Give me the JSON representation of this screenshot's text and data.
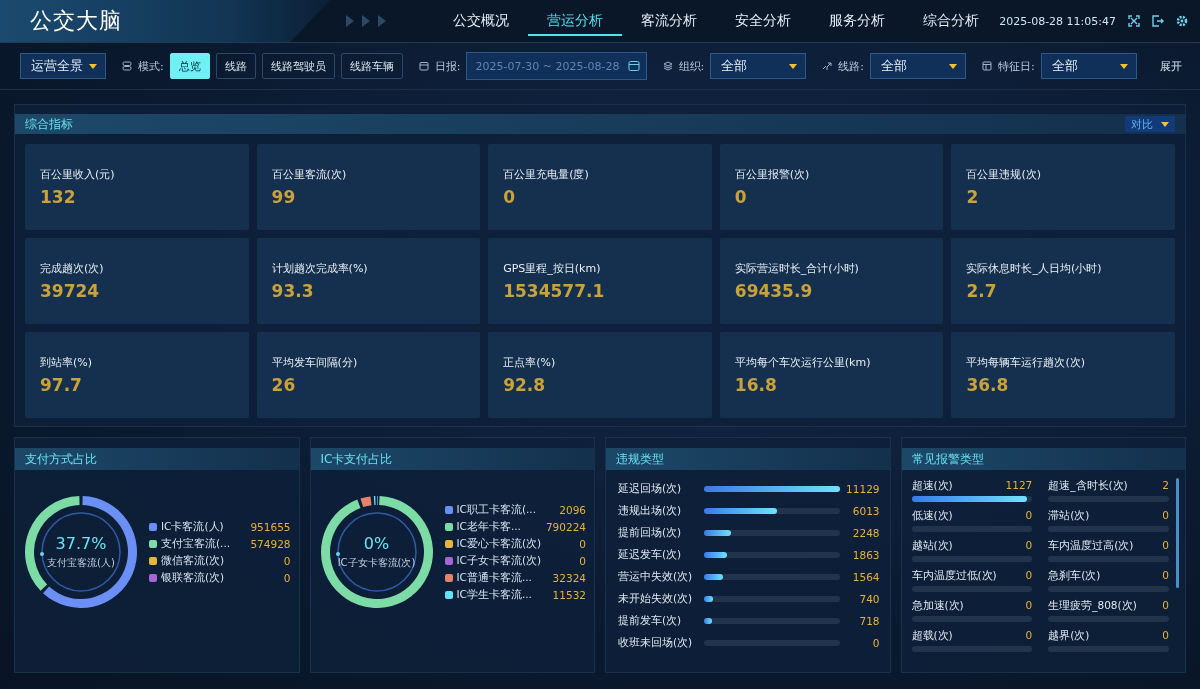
{
  "header": {
    "title": "公交大脑",
    "datetime": "2025-08-28 11:05:47"
  },
  "nav": [
    {
      "label": "公交概况",
      "selected": false
    },
    {
      "label": "营运分析",
      "selected": true
    },
    {
      "label": "客流分析",
      "selected": false
    },
    {
      "label": "安全分析",
      "selected": false
    },
    {
      "label": "服务分析",
      "selected": false
    },
    {
      "label": "综合分析",
      "selected": false
    }
  ],
  "filters": {
    "scene": "运营全景",
    "mode_label": "模式:",
    "modes": [
      {
        "label": "总览",
        "selected": true
      },
      {
        "label": "线路",
        "selected": false
      },
      {
        "label": "线路驾驶员",
        "selected": false
      },
      {
        "label": "线路车辆",
        "selected": false
      }
    ],
    "date_label": "日报:",
    "date_value": "2025-07-30 ~ 2025-08-28",
    "org_label": "组织:",
    "org_value": "全部",
    "route_label": "线路:",
    "route_value": "全部",
    "day_label": "特征日:",
    "day_value": "全部",
    "expand": "展开"
  },
  "metrics": {
    "title": "综合指标",
    "compare": "对比",
    "items": [
      {
        "label": "百公里收入(元)",
        "value": "132"
      },
      {
        "label": "百公里客流(次)",
        "value": "99"
      },
      {
        "label": "百公里充电量(度)",
        "value": "0"
      },
      {
        "label": "百公里报警(次)",
        "value": "0"
      },
      {
        "label": "百公里违规(次)",
        "value": "2"
      },
      {
        "label": "完成趟次(次)",
        "value": "39724"
      },
      {
        "label": "计划趟次完成率(%)",
        "value": "93.3"
      },
      {
        "label": "GPS里程_按日(km)",
        "value": "1534577.1"
      },
      {
        "label": "实际营运时长_合计(小时)",
        "value": "69435.9"
      },
      {
        "label": "实际休息时长_人日均(小时)",
        "value": "2.7"
      },
      {
        "label": "到站率(%)",
        "value": "97.7"
      },
      {
        "label": "平均发车间隔(分)",
        "value": "26"
      },
      {
        "label": "正点率(%)",
        "value": "92.8"
      },
      {
        "label": "平均每个车次运行公里(km)",
        "value": "16.8"
      },
      {
        "label": "平均每辆车运行趟次(次)",
        "value": "36.8"
      }
    ]
  },
  "payment": {
    "title": "支付方式占比",
    "center_value": "37.7%",
    "center_label": "支付宝客流(人)",
    "legend": [
      {
        "label": "IC卡客流(人)",
        "color": "#6b8ff5",
        "value": "951655"
      },
      {
        "label": "支付宝客流(...",
        "color": "#7ddba6",
        "value": "574928"
      },
      {
        "label": "微信客流(次)",
        "color": "#e6b43a",
        "value": "0"
      },
      {
        "label": "银联客流(次)",
        "color": "#a865d6",
        "value": "0"
      }
    ]
  },
  "ic_card": {
    "title": "IC卡支付占比",
    "center_value": "0%",
    "center_label": "IC子女卡客流(次)",
    "legend": [
      {
        "label": "IC职工卡客流(...",
        "color": "#6b8ff5",
        "value": "2096"
      },
      {
        "label": "IC老年卡客...",
        "color": "#7ddba6",
        "value": "790224"
      },
      {
        "label": "IC爱心卡客流(次)",
        "color": "#e6b43a",
        "value": "0"
      },
      {
        "label": "IC子女卡客流(次)",
        "color": "#a865d6",
        "value": "0"
      },
      {
        "label": "IC普通卡客流...",
        "color": "#e5826a",
        "value": "32324"
      },
      {
        "label": "IC学生卡客流...",
        "color": "#5fe3f5",
        "value": "11532"
      }
    ]
  },
  "violations": {
    "title": "违规类型",
    "items": [
      {
        "label": "延迟回场(次)",
        "value": "11129",
        "level": 1
      },
      {
        "label": "违规出场(次)",
        "value": "6013",
        "level": 0.54
      },
      {
        "label": "提前回场(次)",
        "value": "2248",
        "level": 0.2
      },
      {
        "label": "延迟发车(次)",
        "value": "1863",
        "level": 0.17
      },
      {
        "label": "营运中失效(次)",
        "value": "1564",
        "level": 0.14
      },
      {
        "label": "未开始失效(次)",
        "value": "740",
        "level": 0.07
      },
      {
        "label": "提前发车(次)",
        "value": "718",
        "level": 0.06
      },
      {
        "label": "收班未回场(次)",
        "value": "0"
      }
    ]
  },
  "alarms": {
    "title": "常见报警类型",
    "items": [
      {
        "label": "超速(次)",
        "value": "1127",
        "level": 0.96
      },
      {
        "label": "超速_含时长(次)",
        "value": "2"
      },
      {
        "label": "低速(次)",
        "value": "0"
      },
      {
        "label": "滞站(次)",
        "value": "0"
      },
      {
        "label": "越站(次)",
        "value": "0"
      },
      {
        "label": "车内温度过高(次)",
        "value": "0"
      },
      {
        "label": "车内温度过低(次)",
        "value": "0"
      },
      {
        "label": "急刹车(次)",
        "value": "0"
      },
      {
        "label": "急加速(次)",
        "value": "0"
      },
      {
        "label": "生理疲劳_808(次)",
        "value": "0"
      },
      {
        "label": "超载(次)",
        "value": "0"
      },
      {
        "label": "越界(次)",
        "value": "0"
      }
    ]
  }
}
